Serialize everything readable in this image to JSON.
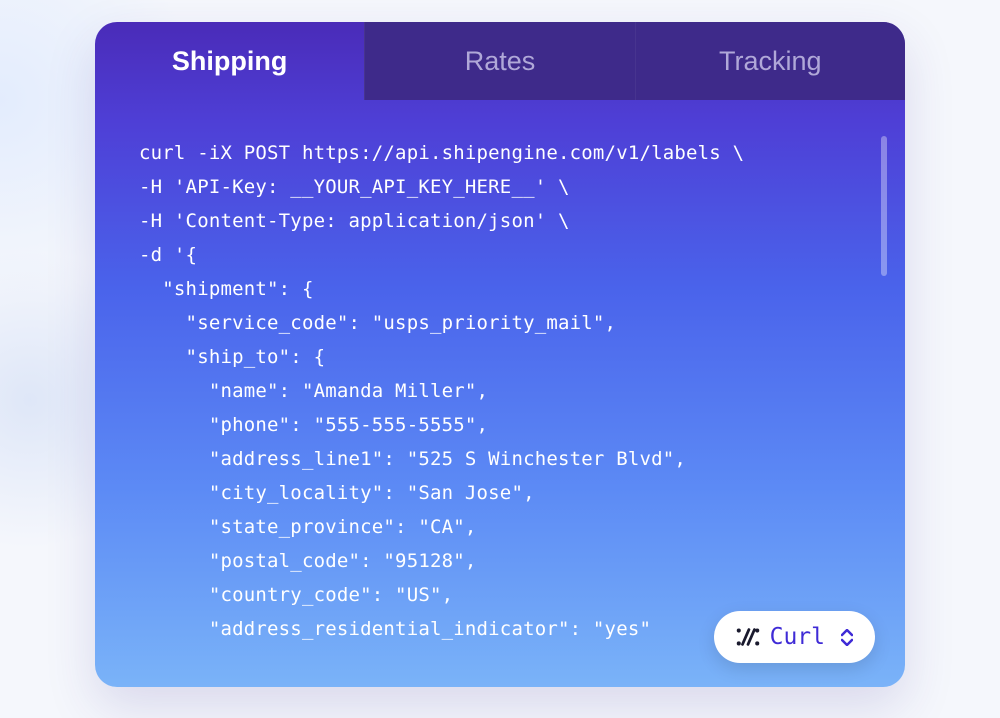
{
  "tabs": [
    {
      "label": "Shipping",
      "active": true
    },
    {
      "label": "Rates",
      "active": false
    },
    {
      "label": "Tracking",
      "active": false
    }
  ],
  "code": "curl -iX POST https://api.shipengine.com/v1/labels \\\n-H 'API-Key: __YOUR_API_KEY_HERE__' \\\n-H 'Content-Type: application/json' \\\n-d '{\n  \"shipment\": {\n    \"service_code\": \"usps_priority_mail\",\n    \"ship_to\": {\n      \"name\": \"Amanda Miller\",\n      \"phone\": \"555-555-5555\",\n      \"address_line1\": \"525 S Winchester Blvd\",\n      \"city_locality\": \"San Jose\",\n      \"state_province\": \"CA\",\n      \"postal_code\": \"95128\",\n      \"country_code\": \"US\",\n      \"address_residential_indicator\": \"yes\"",
  "lang_selector": {
    "icon_glyph": ":⁄⁄",
    "label": "Curl"
  }
}
